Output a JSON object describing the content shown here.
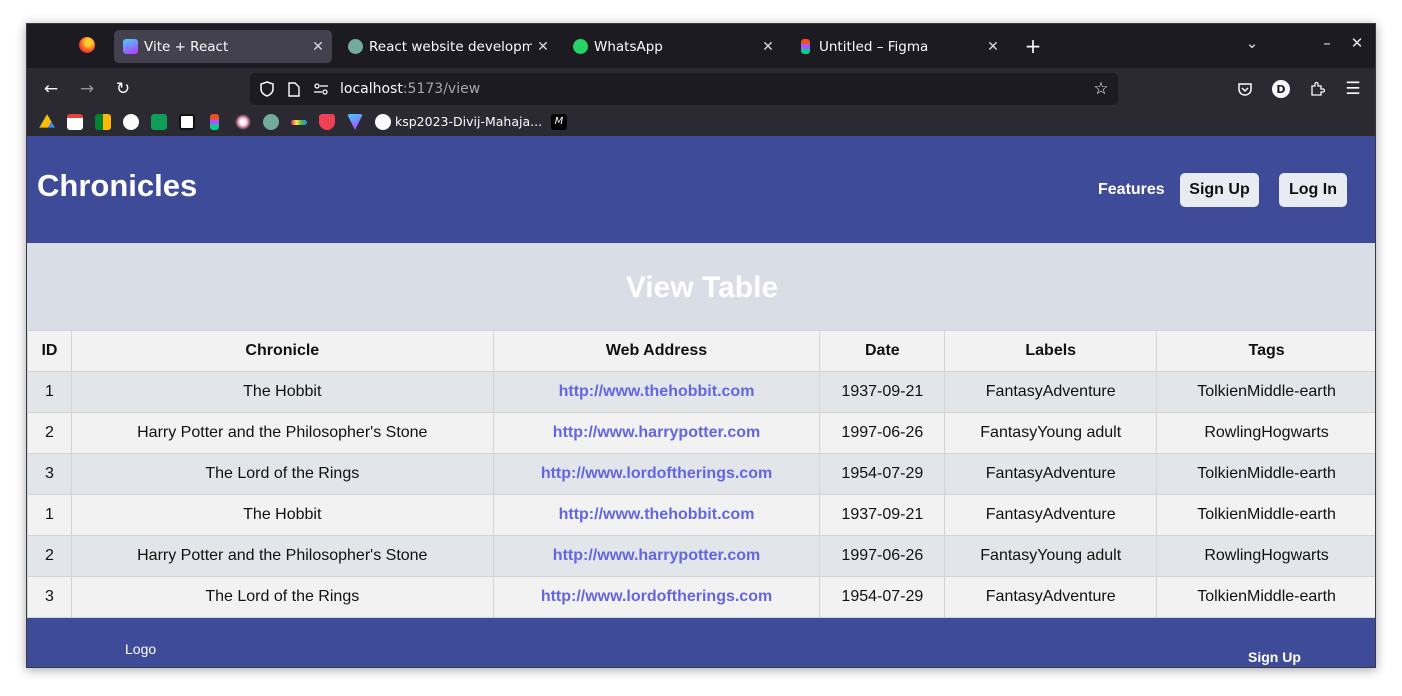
{
  "browser": {
    "tabs": [
      {
        "title": "Vite + React",
        "active": true
      },
      {
        "title": "React website development",
        "active": false
      },
      {
        "title": "WhatsApp",
        "active": false
      },
      {
        "title": "Untitled – Figma",
        "active": false
      }
    ],
    "url": {
      "host": "localhost",
      "path": ":5173/view"
    },
    "bookmarks": [
      {
        "icon": "google-drive-icon"
      },
      {
        "icon": "gmail-icon"
      },
      {
        "icon": "google-meet-icon"
      },
      {
        "icon": "github-icon"
      },
      {
        "icon": "sheets-icon"
      },
      {
        "icon": "notion-icon"
      },
      {
        "icon": "figma-icon"
      },
      {
        "icon": "sparkle-icon"
      },
      {
        "icon": "chatgpt-icon"
      },
      {
        "icon": "color-bar-icon"
      },
      {
        "icon": "pocket-icon"
      },
      {
        "icon": "vite-icon"
      },
      {
        "icon": "github-icon",
        "label": "ksp2023-Divij-Mahaja..."
      },
      {
        "icon": "m-icon"
      }
    ],
    "profile_initial": "D"
  },
  "header": {
    "brand": "Chronicles",
    "features_label": "Features",
    "signup_label": "Sign Up",
    "login_label": "Log In"
  },
  "view": {
    "title": "View Table"
  },
  "table": {
    "columns": [
      "ID",
      "Chronicle",
      "Web Address",
      "Date",
      "Labels",
      "Tags"
    ],
    "rows": [
      {
        "id": "1",
        "chronicle": "The Hobbit",
        "web": "http://www.thehobbit.com",
        "date": "1937-09-21",
        "labels": "FantasyAdventure",
        "tags": "TolkienMiddle-earth"
      },
      {
        "id": "2",
        "chronicle": "Harry Potter and the Philosopher's Stone",
        "web": "http://www.harrypotter.com",
        "date": "1997-06-26",
        "labels": "FantasyYoung adult",
        "tags": "RowlingHogwarts"
      },
      {
        "id": "3",
        "chronicle": "The Lord of the Rings",
        "web": "http://www.lordoftherings.com",
        "date": "1954-07-29",
        "labels": "FantasyAdventure",
        "tags": "TolkienMiddle-earth"
      },
      {
        "id": "1",
        "chronicle": "The Hobbit",
        "web": "http://www.thehobbit.com",
        "date": "1937-09-21",
        "labels": "FantasyAdventure",
        "tags": "TolkienMiddle-earth"
      },
      {
        "id": "2",
        "chronicle": "Harry Potter and the Philosopher's Stone",
        "web": "http://www.harrypotter.com",
        "date": "1997-06-26",
        "labels": "FantasyYoung adult",
        "tags": "RowlingHogwarts"
      },
      {
        "id": "3",
        "chronicle": "The Lord of the Rings",
        "web": "http://www.lordoftherings.com",
        "date": "1954-07-29",
        "labels": "FantasyAdventure",
        "tags": "TolkienMiddle-earth"
      }
    ]
  },
  "footer": {
    "logo_label": "Logo",
    "signup_label": "Sign Up"
  },
  "colors": {
    "header_bg": "#3e4b99",
    "band_bg": "#d8dde6",
    "link": "#6366e0"
  }
}
